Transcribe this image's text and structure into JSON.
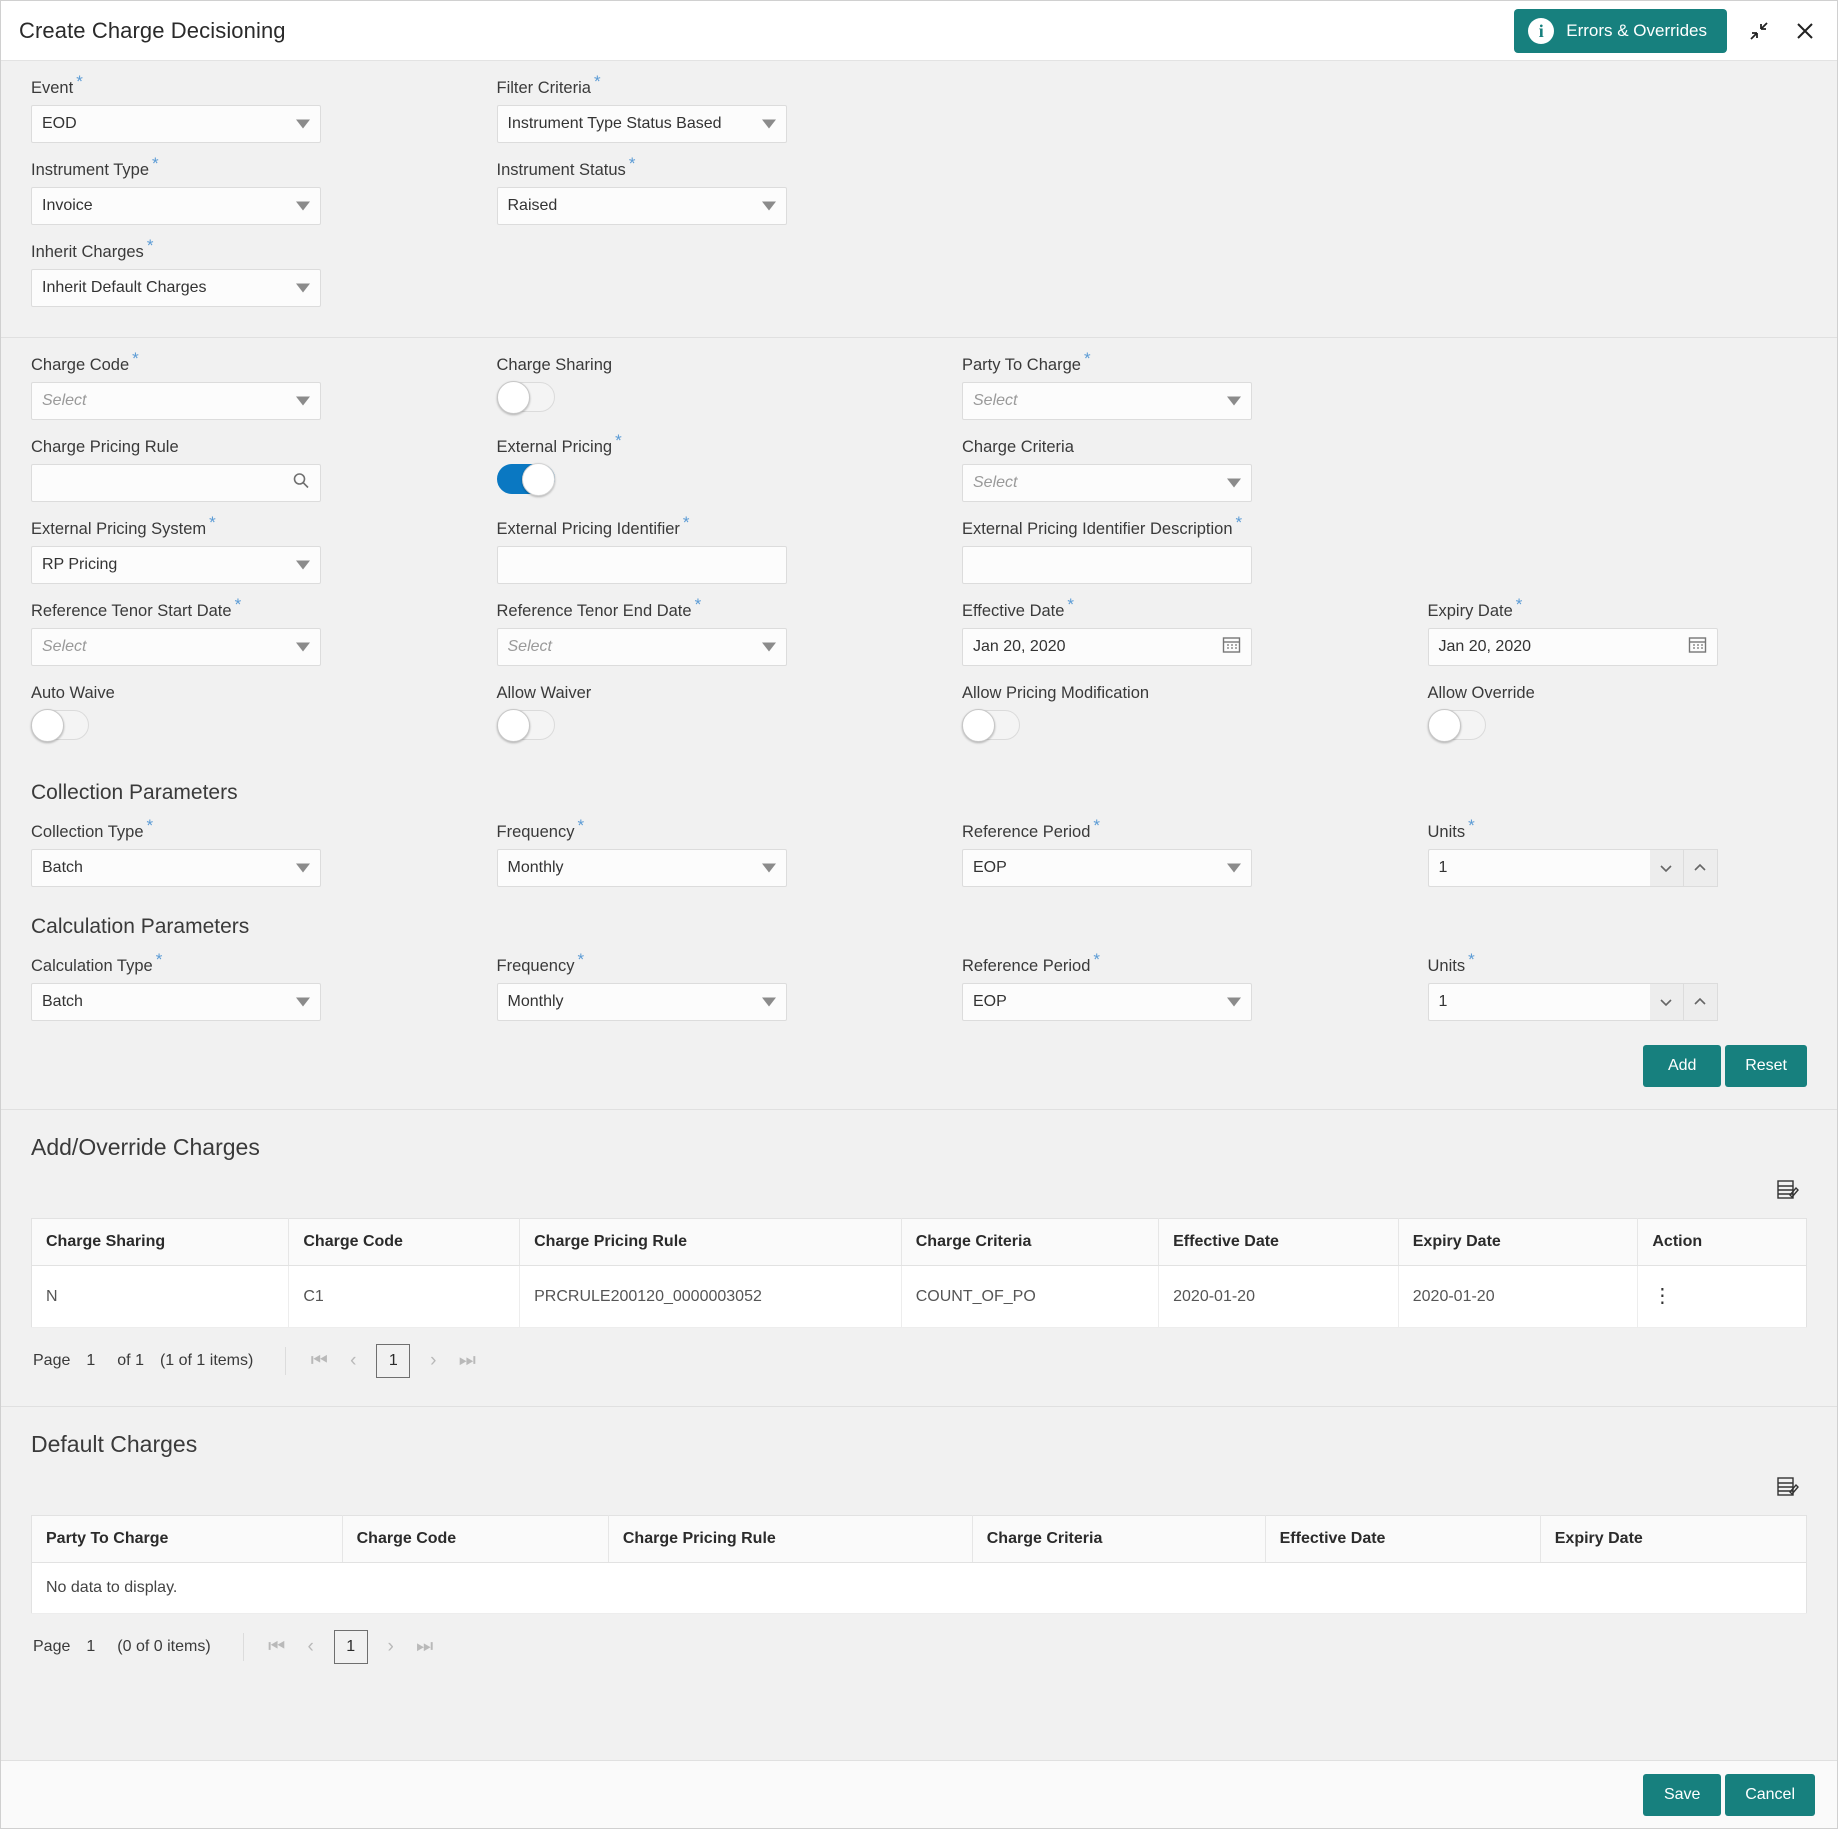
{
  "window": {
    "title": "Create Charge Decisioning",
    "errors_overrides_label": "Errors & Overrides",
    "info_glyph": "i"
  },
  "top_form": {
    "event": {
      "label": "Event",
      "required": true,
      "value": "EOD"
    },
    "filter_criteria": {
      "label": "Filter Criteria",
      "required": true,
      "value": "Instrument Type Status Based"
    },
    "instrument_type": {
      "label": "Instrument Type",
      "required": true,
      "value": "Invoice"
    },
    "instrument_status": {
      "label": "Instrument Status",
      "required": true,
      "value": "Raised"
    },
    "inherit_charges": {
      "label": "Inherit Charges",
      "required": true,
      "value": "Inherit Default Charges"
    }
  },
  "charge_form": {
    "charge_code": {
      "label": "Charge Code",
      "placeholder": "Select"
    },
    "charge_sharing": {
      "label": "Charge Sharing",
      "state": "off"
    },
    "party_to_charge": {
      "label": "Party To Charge",
      "placeholder": "Select"
    },
    "charge_pricing_rule": {
      "label": "Charge Pricing Rule",
      "value": ""
    },
    "external_pricing": {
      "label": "External Pricing",
      "state": "on"
    },
    "charge_criteria": {
      "label": "Charge Criteria",
      "placeholder": "Select"
    },
    "external_pricing_system": {
      "label": "External Pricing System",
      "value": "RP Pricing"
    },
    "external_pricing_identifier": {
      "label": "External Pricing Identifier",
      "value": ""
    },
    "external_pricing_identifier_description": {
      "label": "External Pricing Identifier Description",
      "value": ""
    },
    "reference_tenor_start_date": {
      "label": "Reference Tenor Start Date",
      "placeholder": "Select"
    },
    "reference_tenor_end_date": {
      "label": "Reference Tenor End Date",
      "placeholder": "Select"
    },
    "effective_date": {
      "label": "Effective Date",
      "value": "Jan 20, 2020"
    },
    "expiry_date": {
      "label": "Expiry Date",
      "value": "Jan 20, 2020"
    },
    "auto_waive": {
      "label": "Auto Waive",
      "state": "off"
    },
    "allow_waiver": {
      "label": "Allow Waiver",
      "state": "off"
    },
    "allow_pricing_modification": {
      "label": "Allow Pricing Modification",
      "state": "off"
    },
    "allow_override": {
      "label": "Allow Override",
      "state": "off"
    }
  },
  "collection_parameters": {
    "heading": "Collection Parameters",
    "collection_type": {
      "label": "Collection Type",
      "value": "Batch"
    },
    "frequency": {
      "label": "Frequency",
      "value": "Monthly"
    },
    "reference_period": {
      "label": "Reference Period",
      "value": "EOP"
    },
    "units": {
      "label": "Units",
      "value": "1"
    }
  },
  "calculation_parameters": {
    "heading": "Calculation Parameters",
    "calculation_type": {
      "label": "Calculation Type",
      "value": "Batch"
    },
    "frequency": {
      "label": "Frequency",
      "value": "Monthly"
    },
    "reference_period": {
      "label": "Reference Period",
      "value": "EOP"
    },
    "units": {
      "label": "Units",
      "value": "1"
    }
  },
  "form_actions": {
    "add_label": "Add",
    "reset_label": "Reset"
  },
  "add_override_charges": {
    "heading": "Add/Override Charges",
    "columns": [
      "Charge Sharing",
      "Charge Code",
      "Charge Pricing Rule",
      "Charge Criteria",
      "Effective Date",
      "Expiry Date",
      "Action"
    ],
    "rows": [
      {
        "charge_sharing": "N",
        "charge_code": "C1",
        "charge_pricing_rule": "PRCRULE200120_0000003052",
        "charge_criteria": "COUNT_OF_PO",
        "effective_date": "2020-01-20",
        "expiry_date": "2020-01-20",
        "action": "⋮"
      }
    ],
    "pagination": {
      "page_label": "Page",
      "page_number": "1",
      "of_label": "of 1",
      "items_label": "(1 of 1 items)",
      "current_page": "1"
    }
  },
  "default_charges": {
    "heading": "Default Charges",
    "columns": [
      "Party To Charge",
      "Charge Code",
      "Charge Pricing Rule",
      "Charge Criteria",
      "Effective Date",
      "Expiry Date"
    ],
    "empty_text": "No data to display.",
    "pagination": {
      "page_label": "Page",
      "page_number": "1",
      "items_label": "(0 of 0 items)",
      "current_page": "1"
    }
  },
  "footer": {
    "save_label": "Save",
    "cancel_label": "Cancel"
  },
  "colors": {
    "accent_teal": "#17807e",
    "toggle_on_blue": "#0a78c2",
    "required_star": "#5b9bd5"
  }
}
